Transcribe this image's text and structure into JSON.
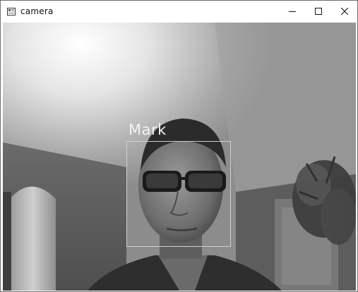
{
  "window": {
    "title": "camera",
    "controls": {
      "minimize": "–",
      "maximize": "☐",
      "close": "✕"
    }
  },
  "detection": {
    "label": "Mark"
  }
}
